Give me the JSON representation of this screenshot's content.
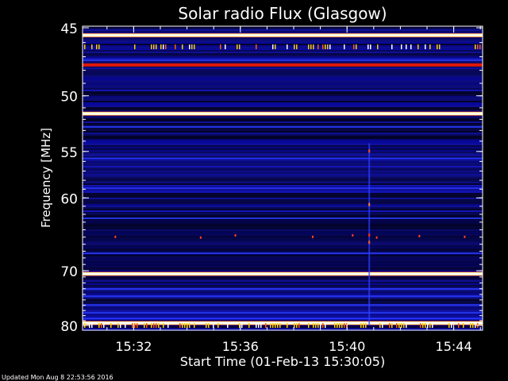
{
  "chart_data": {
    "type": "heatmap",
    "title": "Solar radio Flux (Glasgow)",
    "xlabel": "Start Time (01-Feb-13 15:30:05)",
    "ylabel": "Frequency [MHz]",
    "x_ticks": [
      "15:32",
      "15:36",
      "15:40",
      "15:44"
    ],
    "y_ticks": [
      "45",
      "50",
      "55",
      "60",
      "70",
      "80"
    ],
    "y_axis_scale": "reciprocal",
    "ylim": [
      45,
      80
    ],
    "x_range_minutes": [
      0,
      15
    ],
    "colormap": [
      "#000010",
      "#0a0a70",
      "#1020d0",
      "#ff2000",
      "#ff8000",
      "#ffff80",
      "#ffffff"
    ],
    "bright_bands_mhz": [
      45.5,
      51.5,
      70.5,
      79.5
    ],
    "burst_time": "15:40:50",
    "footer": "Updated Mon Aug  8 22:53:56 2016"
  }
}
